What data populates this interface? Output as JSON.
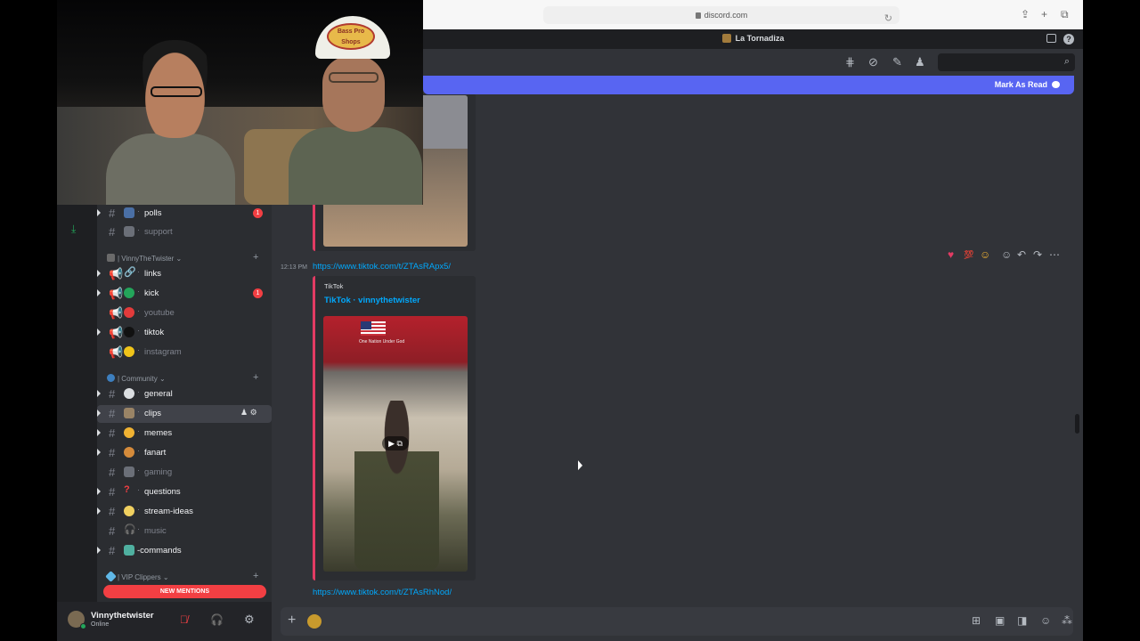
{
  "browser": {
    "url": "discord.com"
  },
  "server": {
    "name": "La Tornadiza"
  },
  "banner": {
    "mark_as_read": "Mark As Read"
  },
  "messages": [
    {
      "time": "12:13 PM",
      "link": "https://www.tiktok.com/t/ZTAsRApx5/",
      "embed_provider": "TikTok",
      "embed_author": "TikTok · vinnythetwister",
      "thumb_caption": "One Nation Under God"
    },
    {
      "link": "https://www.tiktok.com/t/ZTAsRhNod/"
    }
  ],
  "sidebar": {
    "channels_top": [
      {
        "name": "polls",
        "badge": "1",
        "state": "unread"
      },
      {
        "name": "support",
        "state": "muted"
      }
    ],
    "categories": [
      {
        "label": "| VinnyTheTwister",
        "channels": [
          {
            "name": "links",
            "state": "unread"
          },
          {
            "name": "kick",
            "badge": "1",
            "state": "unread"
          },
          {
            "name": "youtube",
            "state": "muted"
          },
          {
            "name": "tiktok",
            "state": "unread"
          },
          {
            "name": "instagram",
            "state": "muted"
          }
        ]
      },
      {
        "label": "| Community",
        "channels": [
          {
            "name": "general",
            "state": "unread"
          },
          {
            "name": "clips",
            "state": "active"
          },
          {
            "name": "memes",
            "state": "unread"
          },
          {
            "name": "fanart",
            "state": "unread"
          },
          {
            "name": "gaming",
            "state": "muted"
          },
          {
            "name": "questions",
            "state": "unread"
          },
          {
            "name": "stream-ideas",
            "state": "unread"
          },
          {
            "name": "music",
            "state": "muted"
          },
          {
            "name": "-commands",
            "state": "unread"
          }
        ]
      },
      {
        "label": "| VIP Clippers",
        "channels": []
      }
    ],
    "new_mentions": "NEW MENTIONS"
  },
  "user": {
    "name": "Vinnythetwister",
    "status": "Online"
  },
  "webcam": {
    "cap_text": "Bass Pro Shops"
  },
  "colors": {
    "accent": "#5865f2",
    "link": "#00a8fc",
    "danger": "#f23f43",
    "embed_border": "#e23b63"
  }
}
